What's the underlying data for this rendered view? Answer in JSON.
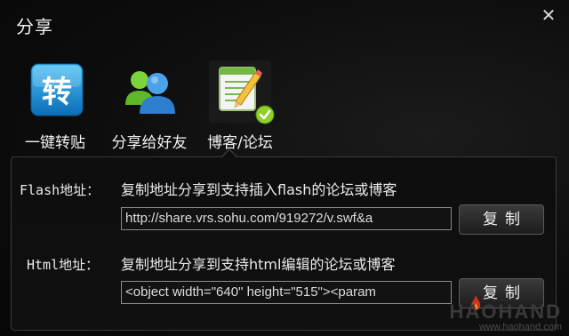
{
  "window": {
    "title": "分享",
    "close_icon": "close-icon",
    "close_symbol": "✕"
  },
  "share_options": [
    {
      "label": "一键转贴",
      "icon": "repost-icon",
      "icon_glyph": "转",
      "color": "#1a8fd6"
    },
    {
      "label": "分享给好友",
      "icon": "friends-icon",
      "color": "#3f8fd8"
    },
    {
      "label": "博客/论坛",
      "icon": "blog-notepad-icon",
      "selected": true,
      "badge_icon": "check-badge-icon",
      "color": "#5fb83a"
    }
  ],
  "flash": {
    "label": "Flash地址：",
    "description": "复制地址分享到支持插入flash的论坛或博客",
    "url": "http://share.vrs.sohu.com/919272/v.swf&a",
    "copy_label": "复制"
  },
  "html": {
    "label": "Html地址：",
    "description": "复制地址分享到支持html编辑的论坛或博客",
    "code": "<object width=\"640\" height=\"515\"><param",
    "copy_label": "复制"
  },
  "watermark": {
    "brand": "HAOHAND",
    "url": "www.haohand.com"
  }
}
